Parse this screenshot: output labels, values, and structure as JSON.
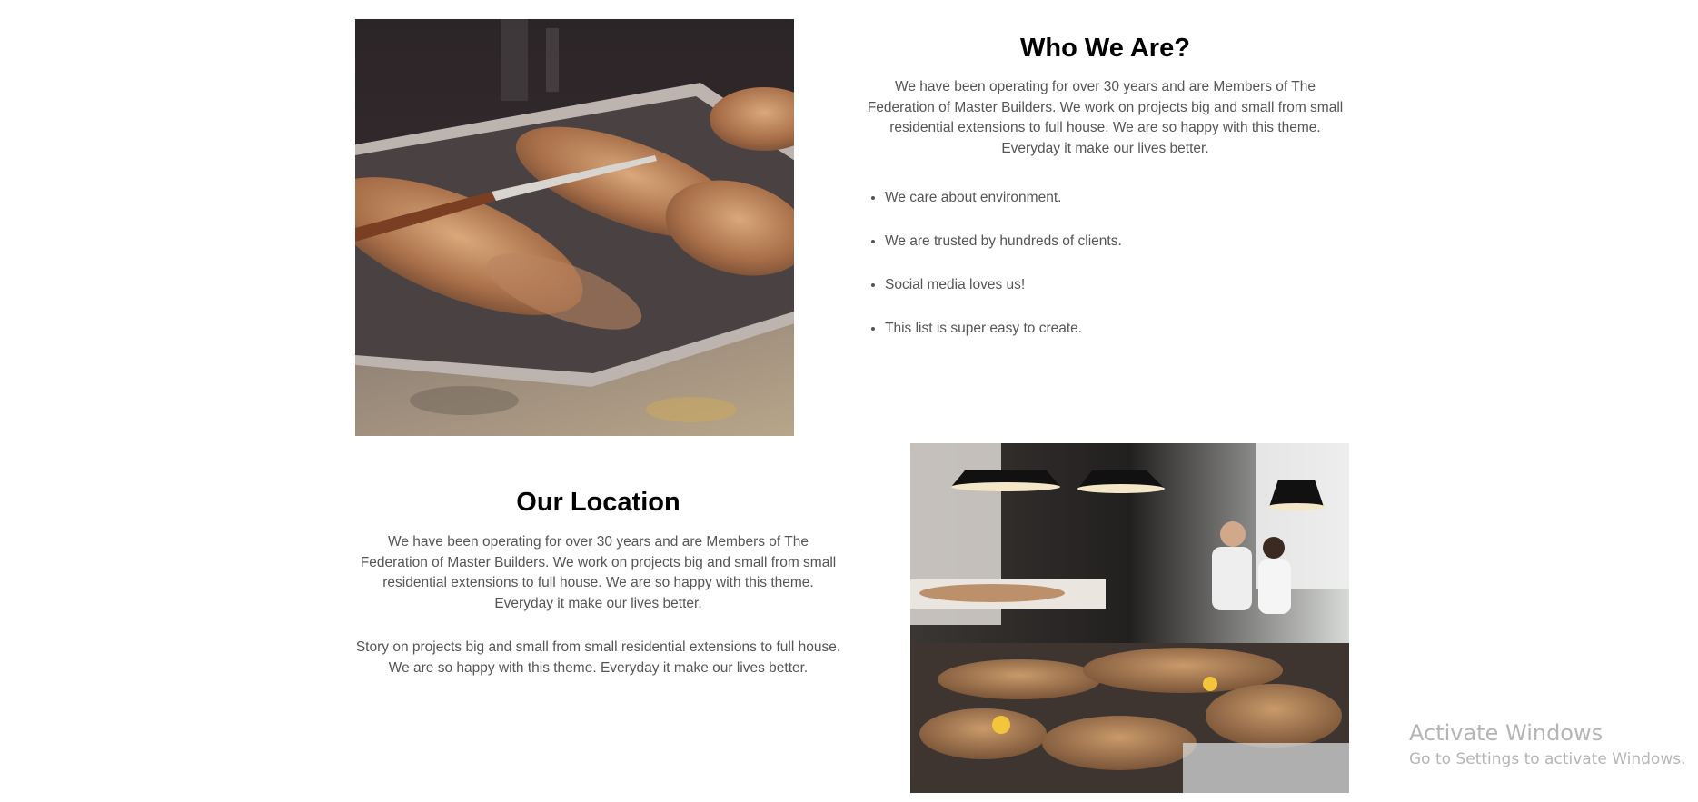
{
  "images": {
    "bread": {
      "alt": "",
      "icon": "bread-tray-photo"
    },
    "shop": {
      "alt": "",
      "icon": "bakery-shop-photo"
    }
  },
  "who_we_are": {
    "title": "Who We Are?",
    "text": "We have been operating for over 30 years and are Members of The Federation of Master Builders. We work on projects big and small from small residential extensions to full house. We are so happy with this theme. Everyday it make our lives better.",
    "list": [
      "We care about environment.",
      "We are trusted by hundreds of clients.",
      "Social media loves us!",
      "This list is super easy to create."
    ]
  },
  "our_location": {
    "title": "Our Location",
    "text": "We have been operating for over 30 years and are Members of The Federation of Master Builders. We work on projects big and small from small residential extensions to full house. We are so happy with this theme. Everyday it make our lives better.",
    "text2": "Story on projects big and small from small residential extensions to full house. We are so happy with this theme. Everyday it make our lives better."
  },
  "watermark": {
    "title": "Activate Windows",
    "subtitle": "Go to Settings to activate Windows."
  }
}
